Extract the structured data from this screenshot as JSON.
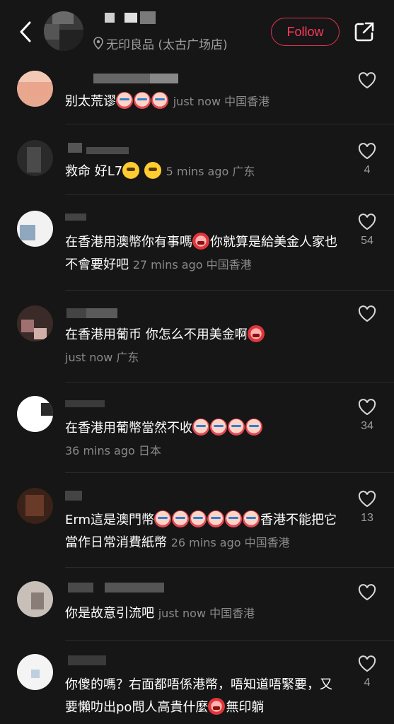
{
  "header": {
    "location": "无印良品 (太古广场店)",
    "follow_label": "Follow"
  },
  "comments": [
    {
      "text": "别太荒谬",
      "emojis": [
        "crying",
        "crying",
        "crying"
      ],
      "meta": "just now 中国香港",
      "likes": ""
    },
    {
      "text": "救命 好L7",
      "emojis": [
        "pleading",
        "pleading"
      ],
      "meta": "5 mins ago 广东",
      "likes": "4"
    },
    {
      "text": "在香港用澳幣你有事嗎",
      "emojis": [
        "red"
      ],
      "text2": "你就算是給美金人家也不會要好吧",
      "meta": "27 mins ago 中国香港",
      "likes": "54"
    },
    {
      "text": "在香港用葡币 你怎么不用美金啊",
      "emojis": [
        "red"
      ],
      "meta": "just now 广东",
      "likes": ""
    },
    {
      "text": "在香港用葡幣當然不收",
      "emojis": [
        "crying",
        "crying",
        "crying",
        "crying"
      ],
      "meta": "36 mins ago 日本",
      "likes": "34"
    },
    {
      "text": "Erm這是澳門幣",
      "emojis": [
        "crying",
        "crying",
        "crying",
        "crying",
        "crying",
        "crying"
      ],
      "text2": "香港不能把它當作日常消費紙幣",
      "meta": "26 mins ago 中国香港",
      "likes": "13"
    },
    {
      "text": "你是故意引流吧",
      "emojis": [],
      "meta": "just now 中国香港",
      "likes": ""
    },
    {
      "text": "你傻的嗎？右面都唔係港幣，唔知道唔緊要，又要懶叻出po問人高貴什麼",
      "emojis": [
        "red"
      ],
      "text2": "無印躺",
      "meta": "",
      "likes": "4"
    }
  ]
}
